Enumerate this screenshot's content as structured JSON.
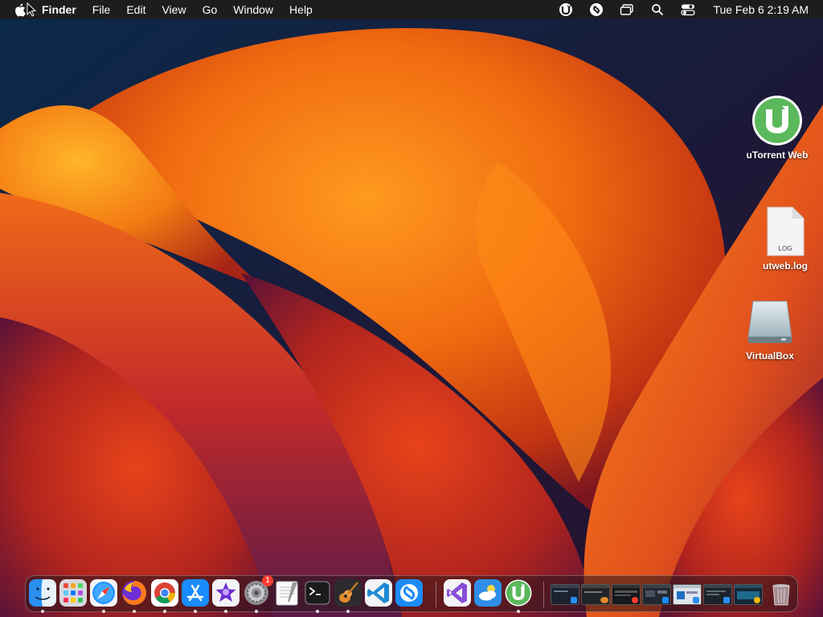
{
  "menubar": {
    "apple_icon": "apple-logo-icon",
    "app_name": "Finder",
    "menus": [
      "File",
      "Edit",
      "View",
      "Go",
      "Window",
      "Help"
    ],
    "status_icons": [
      "utorrent-status-icon",
      "shazam-status-icon",
      "window-switcher-icon",
      "spotlight-search-icon",
      "control-center-icon"
    ],
    "clock": "Tue Feb 6  2:19 AM"
  },
  "desktop": {
    "icons": [
      {
        "label": "uTorrent Web",
        "icon": "utorrent-app-icon"
      },
      {
        "label": "utweb.log",
        "icon": "log-file-icon",
        "file_badge": "LOG"
      },
      {
        "label": "VirtualBox",
        "icon": "external-drive-icon"
      }
    ]
  },
  "dock": {
    "apps": [
      {
        "name": "Finder",
        "icon": "finder-icon",
        "running": true
      },
      {
        "name": "Launchpad",
        "icon": "launchpad-icon",
        "running": false
      },
      {
        "name": "Safari",
        "icon": "safari-icon",
        "running": true
      },
      {
        "name": "Firefox",
        "icon": "firefox-icon",
        "running": true
      },
      {
        "name": "Google Chrome",
        "icon": "chrome-icon",
        "running": true
      },
      {
        "name": "App Store",
        "icon": "app-store-icon",
        "running": true
      },
      {
        "name": "iMovie",
        "icon": "imovie-icon",
        "running": true
      },
      {
        "name": "System Settings",
        "icon": "system-settings-icon",
        "running": true,
        "badge": "1"
      },
      {
        "name": "TextEdit",
        "icon": "textedit-icon",
        "running": false
      },
      {
        "name": "Terminal",
        "icon": "terminal-icon",
        "running": true
      },
      {
        "name": "GarageBand",
        "icon": "garageband-icon",
        "running": true
      },
      {
        "name": "Visual Studio Code",
        "icon": "vscode-icon",
        "running": false
      },
      {
        "name": "Shazam",
        "icon": "shazam-icon",
        "running": false
      },
      {
        "name": "Visual Studio",
        "icon": "visual-studio-icon",
        "running": false
      },
      {
        "name": "Weather",
        "icon": "weather-icon",
        "running": false
      },
      {
        "name": "uTorrent Web",
        "icon": "utorrent-icon",
        "running": true
      }
    ],
    "minimized_windows_count": 7,
    "trash_icon": "trash-icon"
  },
  "colors": {
    "menubar_bg": "#1d1d1f",
    "utorrent_green": "#5bb85b",
    "badge_red": "#ff3b30"
  }
}
